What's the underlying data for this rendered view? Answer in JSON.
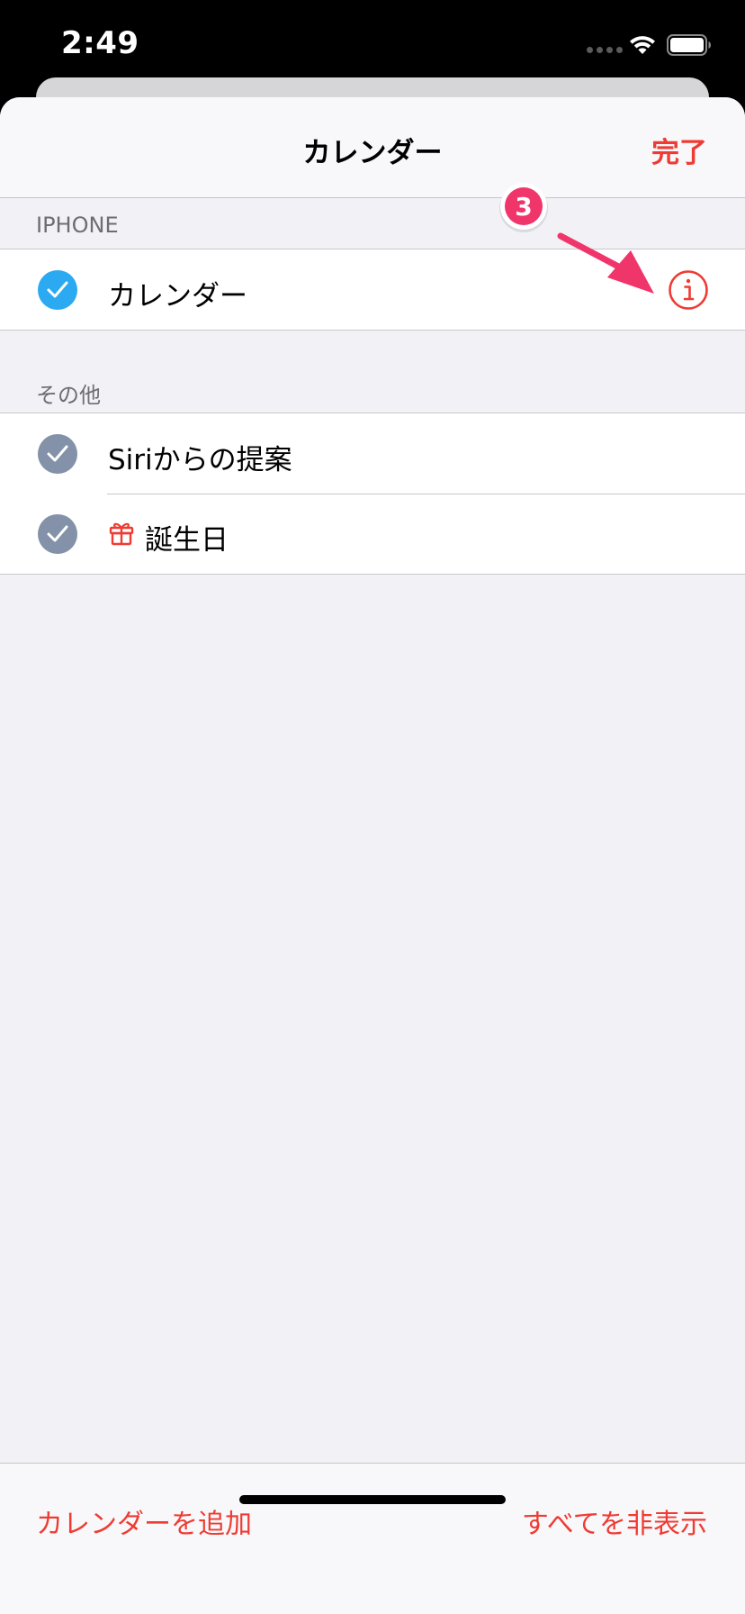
{
  "status_bar": {
    "time": "2:49"
  },
  "nav": {
    "title": "カレンダー",
    "done_label": "完了"
  },
  "sections": [
    {
      "header": "IPHONE",
      "items": [
        {
          "label": "カレンダー",
          "checked": true,
          "check_color": "#2baaf2",
          "has_info": true
        }
      ]
    },
    {
      "header": "その他",
      "items": [
        {
          "label": "Siriからの提案",
          "checked": true,
          "check_color": "#8392a8"
        },
        {
          "label": "誕生日",
          "checked": true,
          "check_color": "#8392a8",
          "icon": "gift-icon"
        }
      ]
    }
  ],
  "annotation": {
    "marker": "3",
    "color": "#f0356b"
  },
  "toolbar": {
    "add_label": "カレンダーを追加",
    "hide_all_label": "すべてを非表示"
  },
  "colors": {
    "accent": "#ef3b33",
    "background": "#f1f1f6"
  }
}
